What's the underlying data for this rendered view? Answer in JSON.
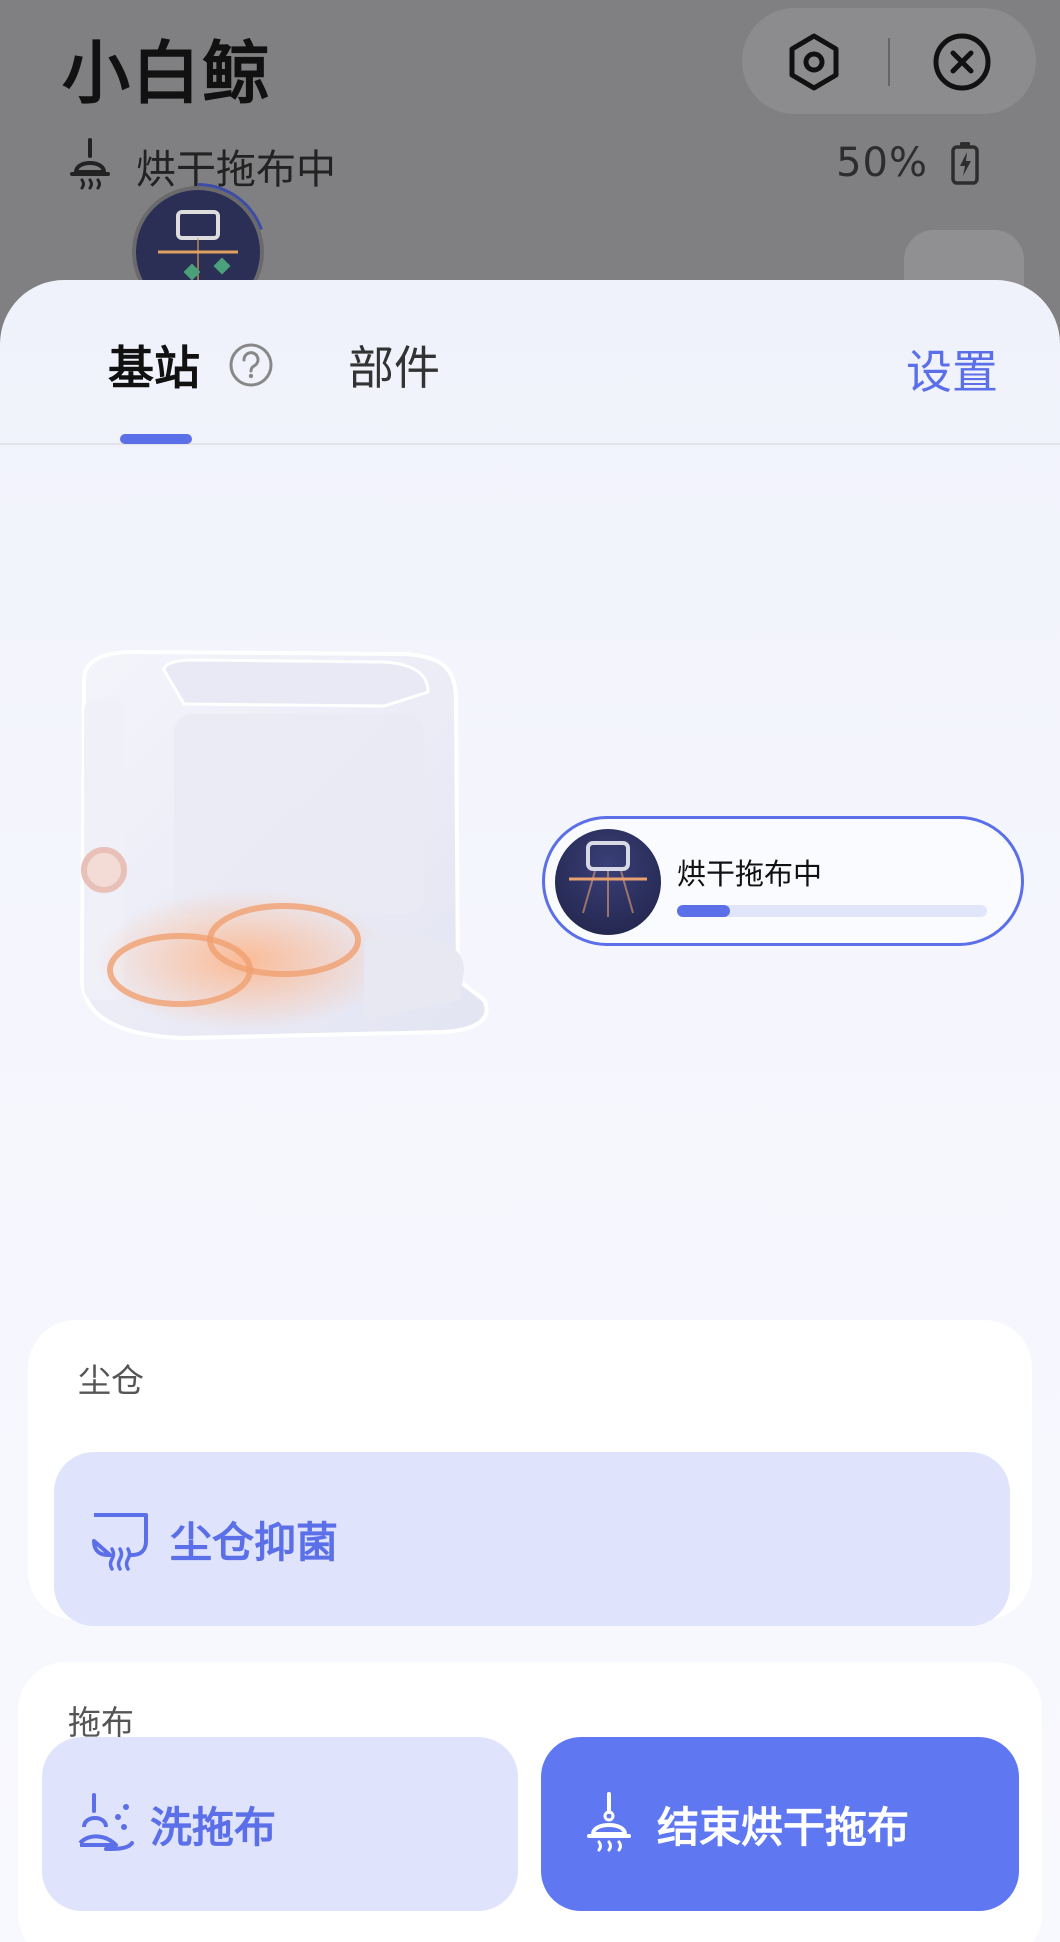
{
  "header": {
    "app_title": "小白鲸",
    "status_text": "烘干拖布中",
    "battery_percent": "50%"
  },
  "tabs": {
    "station_label": "基站",
    "parts_label": "部件",
    "settings_label": "设置",
    "active": "基站"
  },
  "station": {
    "status_label": "烘干拖布中",
    "progress": 0.17
  },
  "dust": {
    "section_title": "尘仓",
    "sterilize_label": "尘仓抑菌"
  },
  "mop": {
    "section_title": "拖布",
    "wash_label": "洗拖布",
    "stop_dry_label": "结束烘干拖布"
  },
  "colors": {
    "accent": "#5b6fe8",
    "accent_light": "#dfe4fc",
    "primary_button": "#5f78f2"
  },
  "icons": [
    "hexagon-settings-icon",
    "close-icon",
    "mop-dry-icon",
    "battery-charging-icon",
    "help-icon",
    "dust-bin-icon",
    "mop-wash-icon",
    "mop-icon"
  ]
}
